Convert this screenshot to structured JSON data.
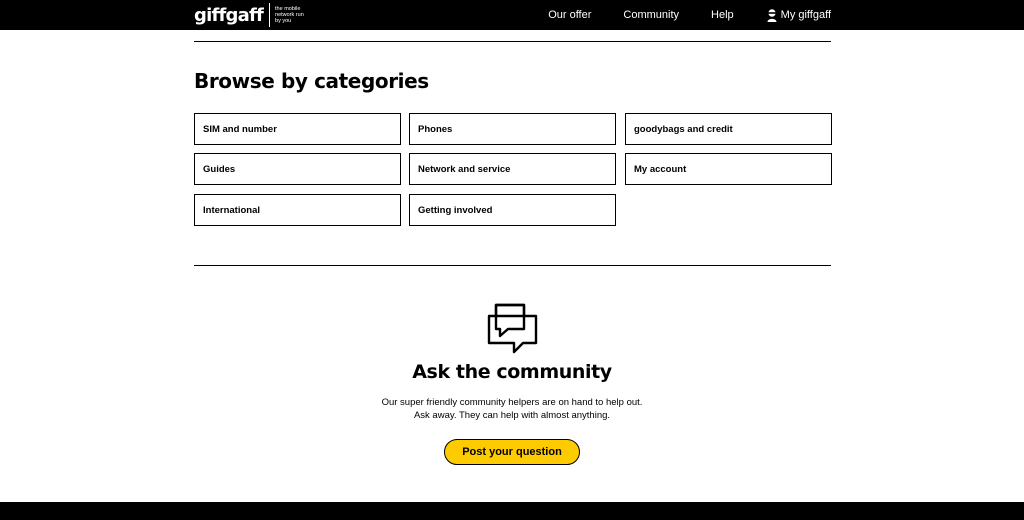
{
  "header": {
    "logo": "giffgaff",
    "tagline": "the mobile network run by you",
    "nav": [
      "Our offer",
      "Community",
      "Help"
    ],
    "account_label": "My giffgaff"
  },
  "categories": {
    "heading": "Browse by categories",
    "items": [
      "SIM and number",
      "Phones",
      "goodybags and credit",
      "Guides",
      "Network and service",
      "My account",
      "International",
      "Getting involved"
    ]
  },
  "community": {
    "icon": "chat-bubbles-icon",
    "title": "Ask the community",
    "text": "Our super friendly community helpers are on hand to help out. Ask away. They can help with almost anything.",
    "button_label": "Post your question",
    "button_color": "#fecb00"
  }
}
